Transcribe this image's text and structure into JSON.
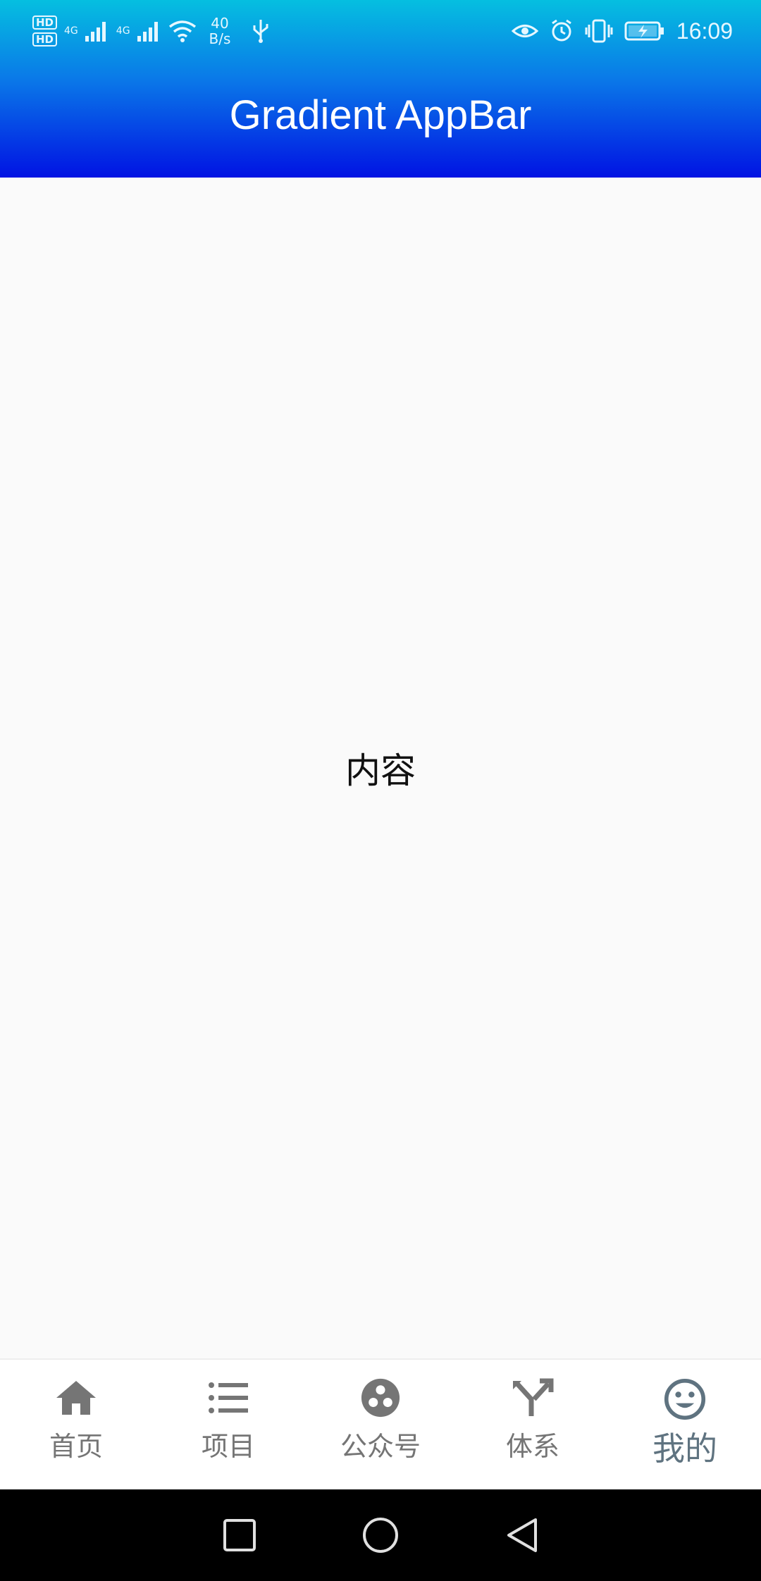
{
  "status_bar": {
    "hd_1": "HD",
    "hd_2": "HD",
    "sim1_network": "4G",
    "sim2_network": "4G",
    "speed_value": "40",
    "speed_unit": "B/s",
    "time": "16:09",
    "icons": [
      "signal-icon",
      "wifi-icon",
      "usb-icon",
      "eye-icon",
      "alarm-icon",
      "vibrate-icon",
      "battery-charging-icon"
    ]
  },
  "appbar": {
    "title": "Gradient AppBar"
  },
  "content": {
    "text": "内容"
  },
  "bottom_nav": {
    "items": [
      {
        "label": "首页",
        "icon": "home-icon"
      },
      {
        "label": "项目",
        "icon": "list-icon"
      },
      {
        "label": "公众号",
        "icon": "group-icon"
      },
      {
        "label": "体系",
        "icon": "fork-icon"
      },
      {
        "label": "我的",
        "icon": "smiley-icon",
        "active": true
      }
    ]
  },
  "system_nav": {
    "icons": [
      "recents-icon",
      "home-circle-icon",
      "back-icon"
    ]
  },
  "colors": {
    "gradient_top": "#05bfe0",
    "gradient_bottom": "#0113e3",
    "nav_inactive": "#757575",
    "nav_active": "#5f7380"
  }
}
